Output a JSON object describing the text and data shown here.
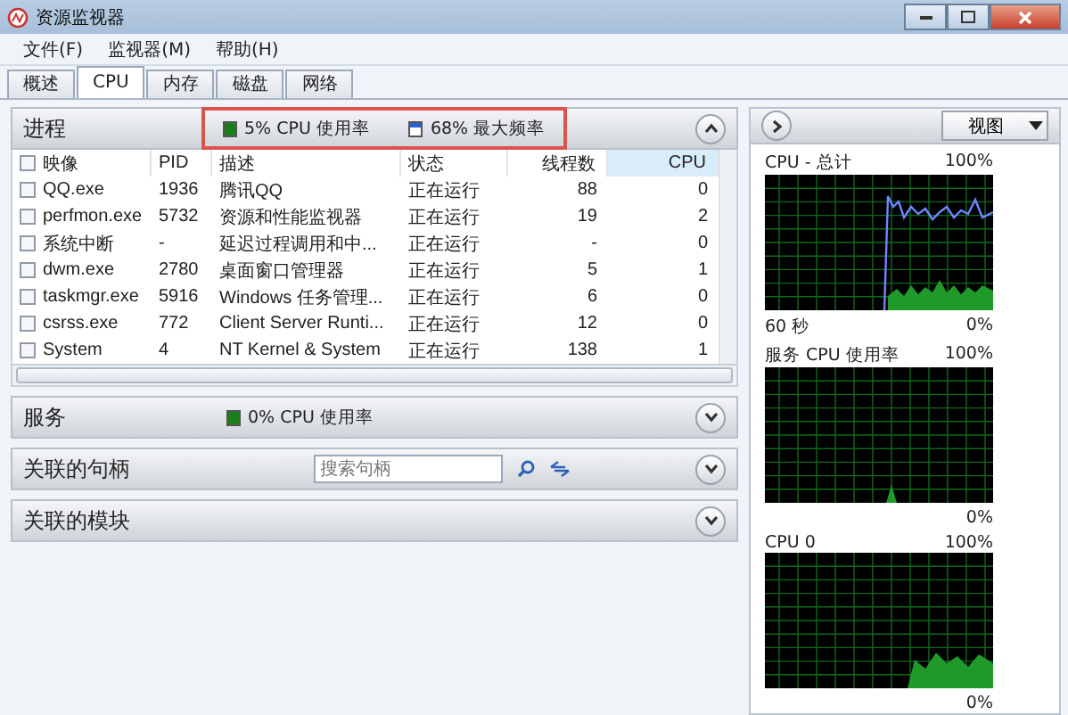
{
  "window": {
    "title": "资源监视器"
  },
  "menu": [
    "文件(F)",
    "监视器(M)",
    "帮助(H)"
  ],
  "tabs": [
    {
      "label": "概述",
      "selected": false
    },
    {
      "label": "CPU",
      "selected": true
    },
    {
      "label": "内存",
      "selected": false
    },
    {
      "label": "磁盘",
      "selected": false
    },
    {
      "label": "网络",
      "selected": false
    }
  ],
  "processes": {
    "title": "进程",
    "expanded": true,
    "usage": "5% CPU 使用率",
    "frequency": "68% 最大频率",
    "columns": [
      {
        "label": "映像",
        "selected": false
      },
      {
        "label": "PID",
        "selected": false
      },
      {
        "label": "描述",
        "selected": false
      },
      {
        "label": "状态",
        "selected": false
      },
      {
        "label": "线程数",
        "selected": false
      },
      {
        "label": "CPU",
        "selected": true
      }
    ],
    "rows": [
      {
        "checked": false,
        "cells": [
          "QQ.exe",
          "1936",
          "腾讯QQ",
          "正在运行",
          "88",
          "0"
        ]
      },
      {
        "checked": false,
        "cells": [
          "perfmon.exe",
          "5732",
          "资源和性能监视器",
          "正在运行",
          "19",
          "2"
        ]
      },
      {
        "checked": false,
        "cells": [
          "系统中断",
          "-",
          "延迟过程调用和中...",
          "正在运行",
          "-",
          "0"
        ]
      },
      {
        "checked": false,
        "cells": [
          "dwm.exe",
          "2780",
          "桌面窗口管理器",
          "正在运行",
          "5",
          "1"
        ]
      },
      {
        "checked": false,
        "cells": [
          "taskmgr.exe",
          "5916",
          "Windows 任务管理...",
          "正在运行",
          "6",
          "0"
        ]
      },
      {
        "checked": false,
        "cells": [
          "csrss.exe",
          "772",
          "Client Server Runti...",
          "正在运行",
          "12",
          "0"
        ]
      },
      {
        "checked": false,
        "cells": [
          "System",
          "4",
          "NT Kernel & System",
          "正在运行",
          "138",
          "1"
        ]
      }
    ]
  },
  "services": {
    "title": "服务",
    "expanded": false,
    "usage": "0% CPU 使用率"
  },
  "handles": {
    "title": "关联的句柄",
    "expanded": false,
    "search": {
      "placeholder": "搜索句柄"
    }
  },
  "modules": {
    "title": "关联的模块",
    "expanded": false
  },
  "graphs_panel": {
    "view_button": "视图",
    "graphs": [
      {
        "title": "CPU - 总计",
        "max": "100%",
        "footer_left": "60 秒",
        "min": "0%",
        "kind": "total"
      },
      {
        "title": "服务 CPU 使用率",
        "max": "100%",
        "min": "0%",
        "kind": "services"
      },
      {
        "title": "CPU 0",
        "max": "100%",
        "min": "0%",
        "kind": "core"
      }
    ]
  }
}
